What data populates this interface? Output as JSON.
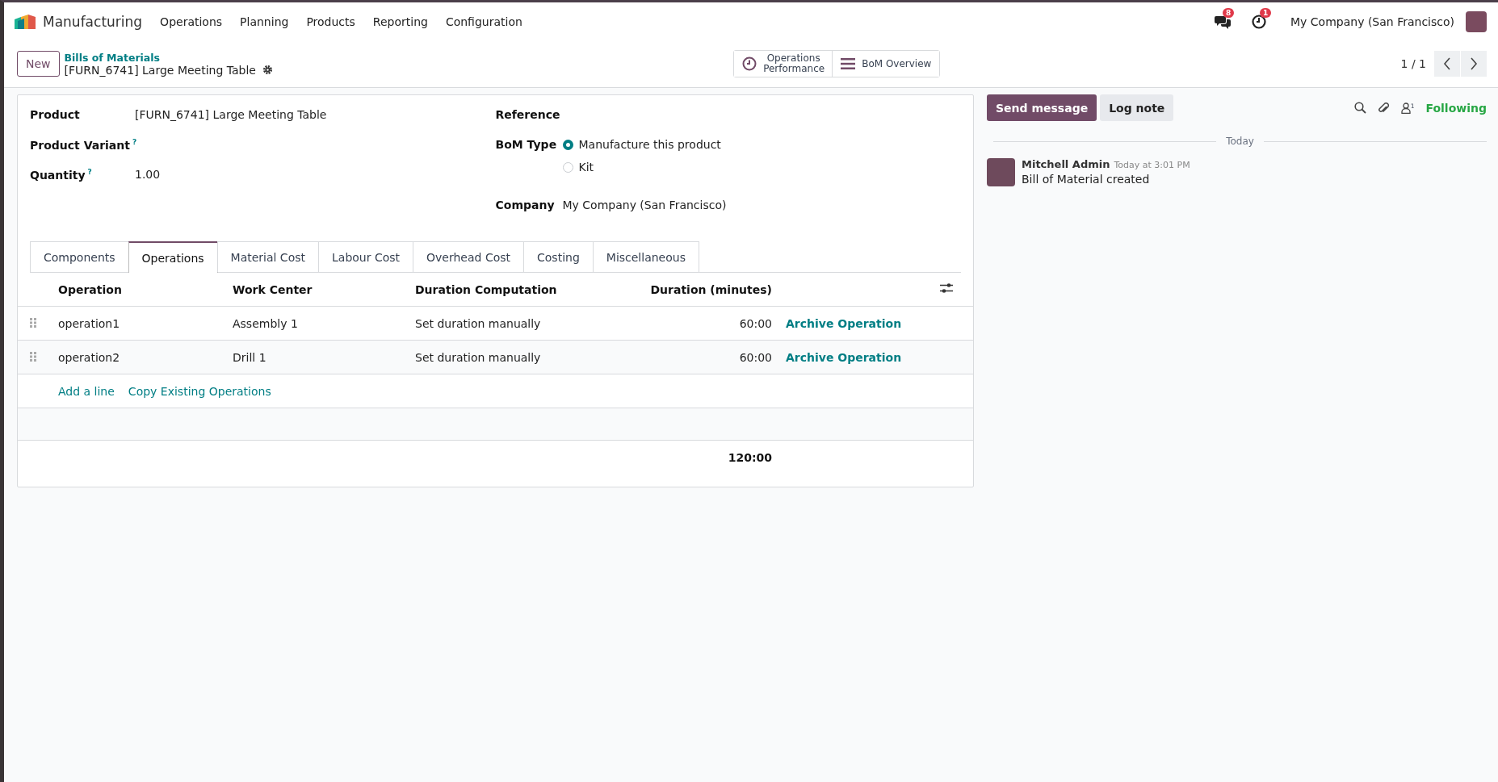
{
  "navbar": {
    "app_name": "Manufacturing",
    "menu": [
      "Operations",
      "Planning",
      "Products",
      "Reporting",
      "Configuration"
    ],
    "messages_badge": "8",
    "activities_badge": "1",
    "company": "My Company (San Francisco)"
  },
  "control_panel": {
    "new_button": "New",
    "breadcrumb": "Bills of Materials",
    "record_title": "[FURN_6741] Large Meeting Table",
    "buttons": [
      {
        "label": "Operations Performance",
        "kind": "clock"
      },
      {
        "label": "BoM Overview",
        "kind": "list"
      }
    ],
    "pager": "1 / 1"
  },
  "form": {
    "left_fields": [
      {
        "label": "Product",
        "value": "[FURN_6741] Large Meeting Table"
      },
      {
        "label": "Product Variant",
        "help_mark": "?"
      },
      {
        "label": "Quantity",
        "help_mark": "?",
        "value": "1.00"
      }
    ],
    "reference_label": "Reference",
    "bom_type_label": "BoM Type",
    "bom_type_options": [
      {
        "label": "Manufacture this product",
        "selected": true
      },
      {
        "label": "Kit",
        "selected": false
      }
    ],
    "company_label": "Company",
    "company_value": "My Company (San Francisco)"
  },
  "tabs": [
    {
      "label": "Components",
      "selected": false
    },
    {
      "label": "Operations",
      "selected": true
    },
    {
      "label": "Material Cost",
      "selected": false
    },
    {
      "label": "Labour Cost",
      "selected": false
    },
    {
      "label": "Overhead Cost",
      "selected": false
    },
    {
      "label": "Costing",
      "selected": false
    },
    {
      "label": "Miscellaneous",
      "selected": false
    }
  ],
  "table": {
    "columns": [
      "Operation",
      "Work Center",
      "Duration Computation",
      "Duration (minutes)"
    ],
    "rows": [
      {
        "operation": "operation1",
        "work_center": "Assembly 1",
        "duration_computation": "Set duration manually",
        "duration": "60:00",
        "action": "Archive Operation"
      },
      {
        "operation": "operation2",
        "work_center": "Drill 1",
        "duration_computation": "Set duration manually",
        "duration": "60:00",
        "action": "Archive Operation"
      }
    ],
    "add_line": "Add a line",
    "copy_existing": "Copy Existing Operations",
    "total": "120:00"
  },
  "chatter": {
    "send_message": "Send message",
    "log_note": "Log note",
    "followers_count": "1",
    "following": "Following",
    "date_separator": "Today",
    "messages": [
      {
        "author": "Mitchell Admin",
        "time": "Today at 3:01 PM",
        "body": "Bill of Material created"
      }
    ]
  }
}
